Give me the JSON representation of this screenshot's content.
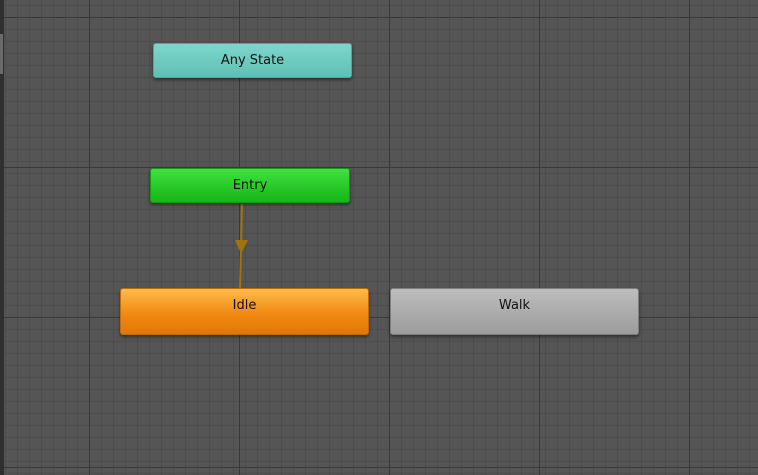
{
  "graph": {
    "states": {
      "any_state": {
        "label": "Any State",
        "color": "#6fcbc0"
      },
      "entry": {
        "label": "Entry",
        "color": "#2ccb2c"
      },
      "idle": {
        "label": "Idle",
        "color": "#f08a12"
      },
      "walk": {
        "label": "Walk",
        "color": "#a9a9a9"
      }
    },
    "transitions": [
      {
        "from": "Entry",
        "to": "Idle",
        "color": "#a0730d"
      }
    ],
    "grid_color": "#555555"
  }
}
